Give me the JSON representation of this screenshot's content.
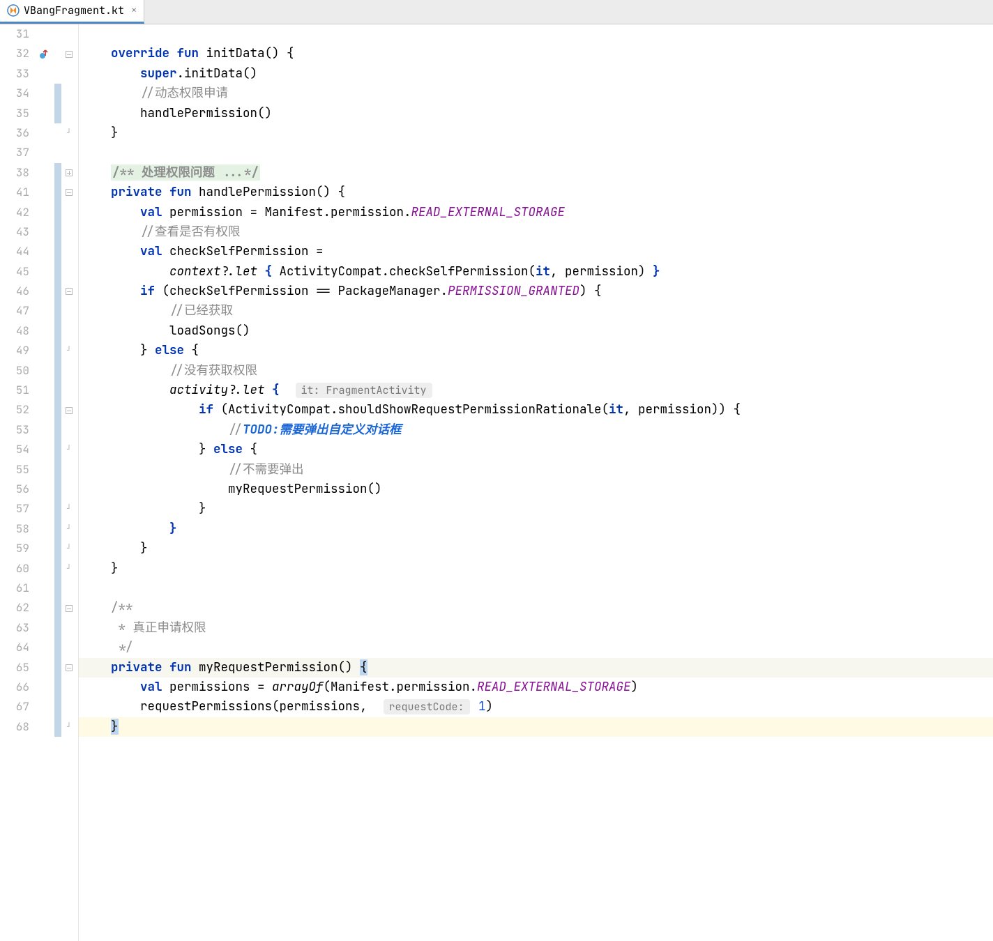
{
  "tab": {
    "label": "VBangFragment.kt",
    "close_glyph": "×"
  },
  "lines": [
    {
      "num": "31",
      "vcs": false,
      "override": false,
      "fold": "",
      "tokens": []
    },
    {
      "num": "32",
      "vcs": false,
      "override": true,
      "fold": "minus",
      "tokens": [
        {
          "cls": "",
          "txt": "    "
        },
        {
          "cls": "kw",
          "txt": "override fun"
        },
        {
          "cls": "",
          "txt": " initData() {"
        }
      ]
    },
    {
      "num": "33",
      "vcs": false,
      "override": false,
      "fold": "",
      "tokens": [
        {
          "cls": "",
          "txt": "        "
        },
        {
          "cls": "kw",
          "txt": "super"
        },
        {
          "cls": "",
          "txt": ".initData()"
        }
      ]
    },
    {
      "num": "34",
      "vcs": true,
      "override": false,
      "fold": "",
      "tokens": [
        {
          "cls": "",
          "txt": "        "
        },
        {
          "cls": "comment",
          "txt": "//动态权限申请"
        }
      ]
    },
    {
      "num": "35",
      "vcs": true,
      "override": false,
      "fold": "",
      "tokens": [
        {
          "cls": "",
          "txt": "        handlePermission()"
        }
      ]
    },
    {
      "num": "36",
      "vcs": false,
      "override": false,
      "fold": "end",
      "tokens": [
        {
          "cls": "",
          "txt": "    }"
        }
      ]
    },
    {
      "num": "37",
      "vcs": false,
      "override": false,
      "fold": "",
      "tokens": []
    },
    {
      "num": "38",
      "vcs": true,
      "override": false,
      "fold": "plus",
      "tokens": [
        {
          "cls": "",
          "txt": "    "
        },
        {
          "cls": "doccomment",
          "txt": "/** 处理权限问题 ...*/"
        }
      ]
    },
    {
      "num": "41",
      "vcs": true,
      "override": false,
      "fold": "minus",
      "tokens": [
        {
          "cls": "",
          "txt": "    "
        },
        {
          "cls": "kw",
          "txt": "private fun"
        },
        {
          "cls": "",
          "txt": " handlePermission() {"
        }
      ]
    },
    {
      "num": "42",
      "vcs": true,
      "override": false,
      "fold": "",
      "tokens": [
        {
          "cls": "",
          "txt": "        "
        },
        {
          "cls": "kw",
          "txt": "val"
        },
        {
          "cls": "",
          "txt": " permission = Manifest.permission."
        },
        {
          "cls": "const",
          "txt": "READ_EXTERNAL_STORAGE"
        }
      ]
    },
    {
      "num": "43",
      "vcs": true,
      "override": false,
      "fold": "",
      "tokens": [
        {
          "cls": "",
          "txt": "        "
        },
        {
          "cls": "comment",
          "txt": "//查看是否有权限"
        }
      ]
    },
    {
      "num": "44",
      "vcs": true,
      "override": false,
      "fold": "",
      "tokens": [
        {
          "cls": "",
          "txt": "        "
        },
        {
          "cls": "kw",
          "txt": "val"
        },
        {
          "cls": "",
          "txt": " checkSelfPermission ="
        }
      ]
    },
    {
      "num": "45",
      "vcs": true,
      "override": false,
      "fold": "",
      "tokens": [
        {
          "cls": "",
          "txt": "            "
        },
        {
          "cls": "ital",
          "txt": "context"
        },
        {
          "cls": "",
          "txt": "?."
        },
        {
          "cls": "ital",
          "txt": "let"
        },
        {
          "cls": "",
          "txt": " "
        },
        {
          "cls": "kw",
          "txt": "{"
        },
        {
          "cls": "",
          "txt": " ActivityCompat.checkSelfPermission("
        },
        {
          "cls": "kw",
          "txt": "it"
        },
        {
          "cls": "",
          "txt": ", permission) "
        },
        {
          "cls": "kw",
          "txt": "}"
        }
      ]
    },
    {
      "num": "46",
      "vcs": true,
      "override": false,
      "fold": "minus",
      "tokens": [
        {
          "cls": "",
          "txt": "        "
        },
        {
          "cls": "kw",
          "txt": "if"
        },
        {
          "cls": "",
          "txt": " (checkSelfPermission == PackageManager."
        },
        {
          "cls": "const",
          "txt": "PERMISSION_GRANTED"
        },
        {
          "cls": "",
          "txt": ") {"
        }
      ]
    },
    {
      "num": "47",
      "vcs": true,
      "override": false,
      "fold": "",
      "tokens": [
        {
          "cls": "",
          "txt": "            "
        },
        {
          "cls": "comment",
          "txt": "//已经获取"
        }
      ]
    },
    {
      "num": "48",
      "vcs": true,
      "override": false,
      "fold": "",
      "tokens": [
        {
          "cls": "",
          "txt": "            loadSongs()"
        }
      ]
    },
    {
      "num": "49",
      "vcs": true,
      "override": false,
      "fold": "end",
      "tokens": [
        {
          "cls": "",
          "txt": "        } "
        },
        {
          "cls": "kw",
          "txt": "else"
        },
        {
          "cls": "",
          "txt": " {"
        }
      ]
    },
    {
      "num": "50",
      "vcs": true,
      "override": false,
      "fold": "",
      "tokens": [
        {
          "cls": "",
          "txt": "            "
        },
        {
          "cls": "comment",
          "txt": "//没有获取权限"
        }
      ]
    },
    {
      "num": "51",
      "vcs": true,
      "override": false,
      "fold": "",
      "tokens": [
        {
          "cls": "",
          "txt": "            "
        },
        {
          "cls": "ital",
          "txt": "activity"
        },
        {
          "cls": "",
          "txt": "?."
        },
        {
          "cls": "ital",
          "txt": "let"
        },
        {
          "cls": "",
          "txt": " "
        },
        {
          "cls": "kw",
          "txt": "{"
        },
        {
          "cls": "",
          "txt": "  "
        },
        {
          "cls": "hint",
          "txt": "it: FragmentActivity"
        }
      ]
    },
    {
      "num": "52",
      "vcs": true,
      "override": false,
      "fold": "minus",
      "tokens": [
        {
          "cls": "",
          "txt": "                "
        },
        {
          "cls": "kw",
          "txt": "if"
        },
        {
          "cls": "",
          "txt": " (ActivityCompat.shouldShowRequestPermissionRationale("
        },
        {
          "cls": "kw",
          "txt": "it"
        },
        {
          "cls": "",
          "txt": ", permission)) {"
        }
      ]
    },
    {
      "num": "53",
      "vcs": true,
      "override": false,
      "fold": "",
      "tokens": [
        {
          "cls": "",
          "txt": "                    "
        },
        {
          "cls": "comment",
          "txt": "//"
        },
        {
          "cls": "todo",
          "txt": "TODO:需要弹出自定义对话框"
        }
      ]
    },
    {
      "num": "54",
      "vcs": true,
      "override": false,
      "fold": "end",
      "tokens": [
        {
          "cls": "",
          "txt": "                } "
        },
        {
          "cls": "kw",
          "txt": "else"
        },
        {
          "cls": "",
          "txt": " {"
        }
      ]
    },
    {
      "num": "55",
      "vcs": true,
      "override": false,
      "fold": "",
      "tokens": [
        {
          "cls": "",
          "txt": "                    "
        },
        {
          "cls": "comment",
          "txt": "//不需要弹出"
        }
      ]
    },
    {
      "num": "56",
      "vcs": true,
      "override": false,
      "fold": "",
      "tokens": [
        {
          "cls": "",
          "txt": "                    myRequestPermission()"
        }
      ]
    },
    {
      "num": "57",
      "vcs": true,
      "override": false,
      "fold": "end",
      "tokens": [
        {
          "cls": "",
          "txt": "                }"
        }
      ]
    },
    {
      "num": "58",
      "vcs": true,
      "override": false,
      "fold": "end",
      "tokens": [
        {
          "cls": "",
          "txt": "            "
        },
        {
          "cls": "kw",
          "txt": "}"
        }
      ]
    },
    {
      "num": "59",
      "vcs": true,
      "override": false,
      "fold": "end",
      "tokens": [
        {
          "cls": "",
          "txt": "        }"
        }
      ]
    },
    {
      "num": "60",
      "vcs": true,
      "override": false,
      "fold": "end",
      "tokens": [
        {
          "cls": "",
          "txt": "    }"
        }
      ]
    },
    {
      "num": "61",
      "vcs": true,
      "override": false,
      "fold": "",
      "tokens": []
    },
    {
      "num": "62",
      "vcs": true,
      "override": false,
      "fold": "minus",
      "tokens": [
        {
          "cls": "",
          "txt": "    "
        },
        {
          "cls": "comment",
          "txt": "/**"
        }
      ]
    },
    {
      "num": "63",
      "vcs": true,
      "override": false,
      "fold": "",
      "tokens": [
        {
          "cls": "",
          "txt": "     "
        },
        {
          "cls": "comment",
          "txt": "* 真正申请权限"
        }
      ]
    },
    {
      "num": "64",
      "vcs": true,
      "override": false,
      "fold": "",
      "tokens": [
        {
          "cls": "",
          "txt": "     "
        },
        {
          "cls": "comment",
          "txt": "*/"
        }
      ]
    },
    {
      "num": "65",
      "vcs": true,
      "override": false,
      "fold": "minus",
      "hl": "dim",
      "tokens": [
        {
          "cls": "",
          "txt": "    "
        },
        {
          "cls": "kw",
          "txt": "private fun"
        },
        {
          "cls": "",
          "txt": " myRequestPermission() "
        },
        {
          "cls": "caret-box",
          "txt": "{"
        }
      ]
    },
    {
      "num": "66",
      "vcs": true,
      "override": false,
      "fold": "",
      "tokens": [
        {
          "cls": "",
          "txt": "        "
        },
        {
          "cls": "kw",
          "txt": "val"
        },
        {
          "cls": "",
          "txt": " permissions = "
        },
        {
          "cls": "ital",
          "txt": "arrayOf"
        },
        {
          "cls": "",
          "txt": "(Manifest.permission."
        },
        {
          "cls": "const",
          "txt": "READ_EXTERNAL_STORAGE"
        },
        {
          "cls": "",
          "txt": ")"
        }
      ]
    },
    {
      "num": "67",
      "vcs": true,
      "override": false,
      "fold": "",
      "tokens": [
        {
          "cls": "",
          "txt": "        requestPermissions(permissions,  "
        },
        {
          "cls": "hint",
          "txt": "requestCode:"
        },
        {
          "cls": "",
          "txt": " "
        },
        {
          "cls": "num",
          "txt": "1"
        },
        {
          "cls": "",
          "txt": ")"
        }
      ]
    },
    {
      "num": "68",
      "vcs": true,
      "override": false,
      "fold": "end",
      "hl": "yellow",
      "tokens": [
        {
          "cls": "",
          "txt": "    "
        },
        {
          "cls": "caret-box",
          "txt": "}"
        }
      ]
    }
  ]
}
